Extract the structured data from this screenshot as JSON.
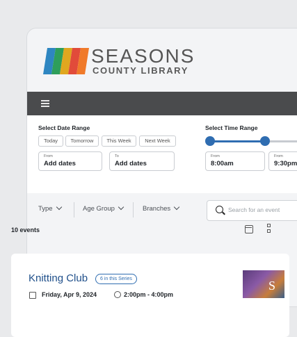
{
  "brand": {
    "name_line1": "SEASONS",
    "name_line2": "COUNTY LIBRARY",
    "stripe_colors": [
      "#2e86c1",
      "#2e9e5b",
      "#e0a71f",
      "#e14b3a",
      "#f07a2a"
    ]
  },
  "nav": {
    "menu_icon": "hamburger-icon"
  },
  "date_range": {
    "label": "Select Date Range",
    "quick_options": [
      "Today",
      "Tomorrow",
      "This Week",
      "Next Week"
    ],
    "from_label": "From",
    "from_value": "Add dates",
    "to_label": "To",
    "to_value": "Add dates"
  },
  "time_range": {
    "label": "Select Time Range",
    "from_label": "From",
    "from_value": "8:00am",
    "to_label": "From",
    "to_value": "9:30pm"
  },
  "filters": {
    "type": "Type",
    "age_group": "Age Group",
    "branches": "Branches",
    "search_placeholder": "Search for an event"
  },
  "results": {
    "count_text": "10 events"
  },
  "event": {
    "title": "Knitting Club",
    "series_badge": "6 in this Series",
    "date": "Friday, Apr 9, 2024",
    "time": "2:00pm - 4:00pm",
    "thumb_letter": "S"
  },
  "colors": {
    "accent": "#2f6db1",
    "navbar": "#4a4b4d",
    "title": "#1f4f8a"
  }
}
